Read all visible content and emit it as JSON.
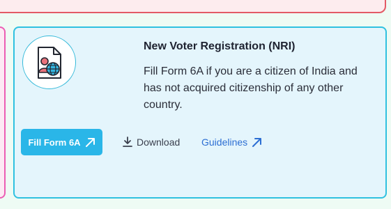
{
  "cards": {
    "nri": {
      "icon": "form-person-globe-icon",
      "title": "New Voter Registration (NRI)",
      "description": "Fill Form 6A if you are a citizen of India and has not acquired citizenship of any other country.",
      "primary_button": {
        "label": "Fill Form 6A",
        "icon": "arrow-up-right-icon"
      },
      "download_link": {
        "label": "Download",
        "icon": "download-icon"
      },
      "guidelines_link": {
        "label": "Guidelines",
        "icon": "arrow-up-right-icon"
      }
    }
  },
  "colors": {
    "card_background": "#e4f5fc",
    "card_border": "#2fc1e0",
    "primary_button": "#2ab6e8",
    "link_blue": "#2c6ed3",
    "top_card_border": "#e35a66",
    "left_card_border": "#ec5db4"
  }
}
